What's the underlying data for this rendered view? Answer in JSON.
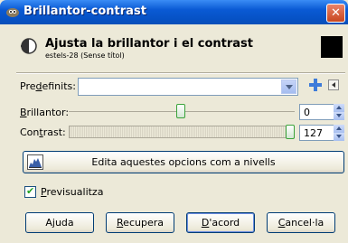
{
  "window": {
    "title": "Brillantor-contrast",
    "close_label": "✕"
  },
  "header": {
    "title": "Ajusta la brillantor i el contrast",
    "subtitle": "estels-28 (Sense títol)"
  },
  "presets": {
    "label_pre": "Pre",
    "label_mn": "d",
    "label_post": "efinits:",
    "value": ""
  },
  "brightness": {
    "label_mn": "B",
    "label_post": "rillantor:",
    "value": "0",
    "level_range": [
      -127,
      127
    ]
  },
  "contrast": {
    "label_pre": "Con",
    "label_mn": "t",
    "label_post": "rast:",
    "value": "127",
    "level_range": [
      -127,
      127
    ]
  },
  "levels_button": {
    "label": "Edita aquestes opcions com a nivells"
  },
  "preview": {
    "label_mn": "P",
    "label_post": "revisualitza",
    "checked": true
  },
  "buttons": {
    "help": "Ajuda",
    "reset_mn": "R",
    "reset_post": "ecupera",
    "ok_mn": "D",
    "ok_post": "'acord",
    "cancel_mn": "C",
    "cancel_post": "ancel·la"
  },
  "icons": {
    "title": "gimp-wilber-icon",
    "header": "brightness-contrast-icon",
    "add_preset": "add-icon",
    "menu": "menu-arrow-icon",
    "levels": "levels-icon"
  },
  "colors": {
    "titlebar": "#0a5ad4",
    "accent": "#3aa33a",
    "background": "#ece9d8"
  }
}
